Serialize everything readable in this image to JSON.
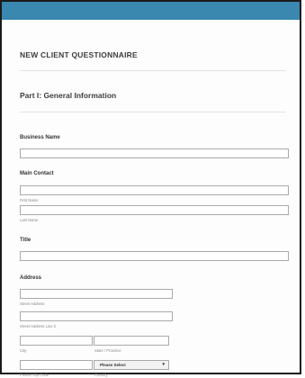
{
  "form": {
    "title": "NEW CLIENT QUESTIONNAIRE",
    "part": "Part I: General Information",
    "business_name_label": "Business Name",
    "main_contact_label": "Main Contact",
    "first_name_sub": "First Name",
    "last_name_sub": "Last Name",
    "title_label": "Title",
    "address_label": "Address",
    "street_sub": "Street Address",
    "street2_sub": "Street Address Line 2",
    "city_sub": "City",
    "state_sub": "State / Province",
    "postal_sub": "Postal / Zip Code",
    "country_sub": "Country",
    "country_value": "Please Select"
  }
}
